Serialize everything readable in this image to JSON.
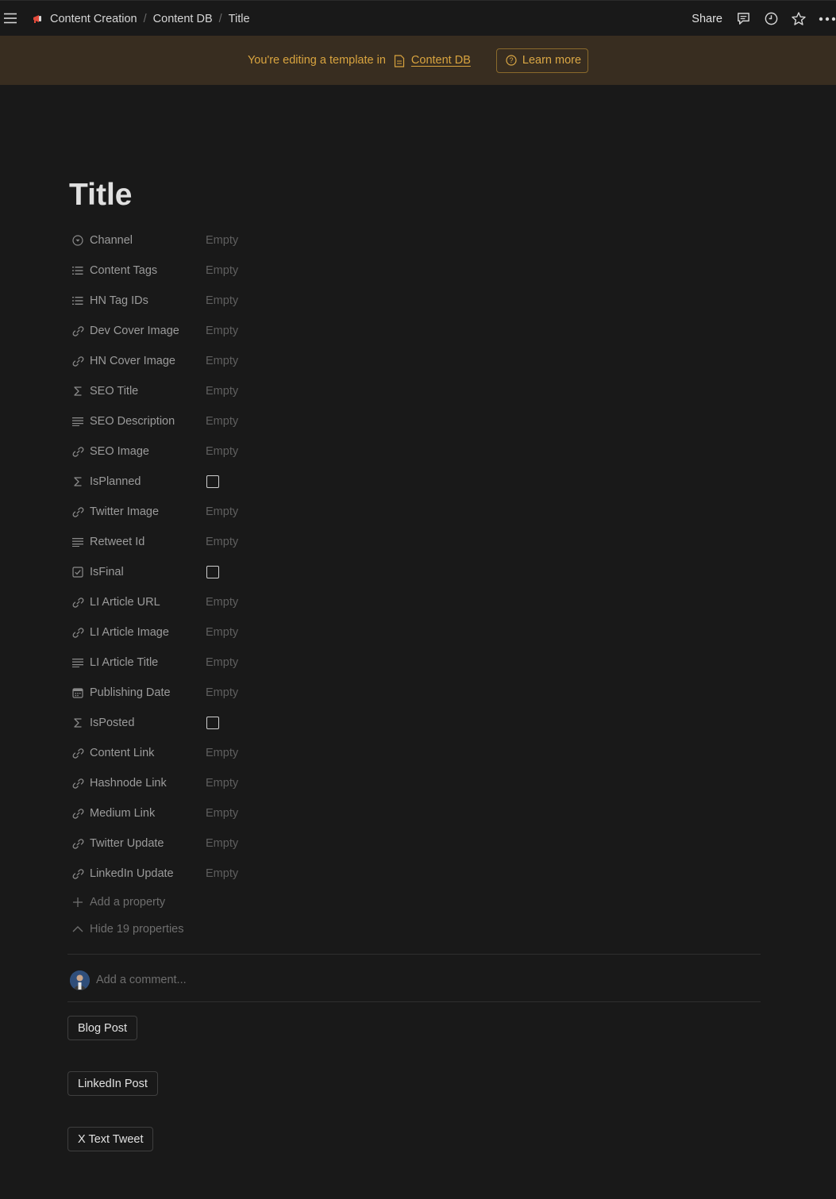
{
  "topbar": {
    "breadcrumbs": [
      "Content Creation",
      "Content DB",
      "Title"
    ],
    "share_label": "Share"
  },
  "banner": {
    "text": "You're editing a template in",
    "link": "Content DB",
    "learn_more": "Learn more"
  },
  "page": {
    "title": "Title"
  },
  "properties": [
    {
      "label": "Channel",
      "icon": "select-icon",
      "value": "Empty",
      "type": "text"
    },
    {
      "label": "Content Tags",
      "icon": "multi-select-icon",
      "value": "Empty",
      "type": "text"
    },
    {
      "label": "HN Tag IDs",
      "icon": "multi-select-icon",
      "value": "Empty",
      "type": "text"
    },
    {
      "label": "Dev Cover Image",
      "icon": "url-icon",
      "value": "Empty",
      "type": "text"
    },
    {
      "label": "HN Cover Image",
      "icon": "url-icon",
      "value": "Empty",
      "type": "text"
    },
    {
      "label": "SEO Title",
      "icon": "formula-icon",
      "value": "Empty",
      "type": "text"
    },
    {
      "label": "SEO Description",
      "icon": "text-icon",
      "value": "Empty",
      "type": "text"
    },
    {
      "label": "SEO Image",
      "icon": "url-icon",
      "value": "Empty",
      "type": "text"
    },
    {
      "label": "IsPlanned",
      "icon": "formula-icon",
      "value": "",
      "type": "checkbox"
    },
    {
      "label": "Twitter Image",
      "icon": "url-icon",
      "value": "Empty",
      "type": "text"
    },
    {
      "label": "Retweet Id",
      "icon": "text-icon",
      "value": "Empty",
      "type": "text"
    },
    {
      "label": "IsFinal",
      "icon": "checkbox-icon",
      "value": "",
      "type": "checkbox"
    },
    {
      "label": "LI Article URL",
      "icon": "url-icon",
      "value": "Empty",
      "type": "text"
    },
    {
      "label": "LI Article Image",
      "icon": "url-icon",
      "value": "Empty",
      "type": "text"
    },
    {
      "label": "LI Article Title",
      "icon": "text-icon",
      "value": "Empty",
      "type": "text"
    },
    {
      "label": "Publishing Date",
      "icon": "calendar-icon",
      "value": "Empty",
      "type": "text"
    },
    {
      "label": "IsPosted",
      "icon": "formula-icon",
      "value": "",
      "type": "checkbox"
    },
    {
      "label": "Content Link",
      "icon": "url-icon",
      "value": "Empty",
      "type": "text"
    },
    {
      "label": "Hashnode Link",
      "icon": "url-icon",
      "value": "Empty",
      "type": "text"
    },
    {
      "label": "Medium Link",
      "icon": "url-icon",
      "value": "Empty",
      "type": "text"
    },
    {
      "label": "Twitter Update",
      "icon": "url-icon",
      "value": "Empty",
      "type": "text"
    },
    {
      "label": "LinkedIn Update",
      "icon": "url-icon",
      "value": "Empty",
      "type": "text"
    }
  ],
  "add_property_label": "Add a property",
  "hide_properties_label": "Hide 19 properties",
  "comment": {
    "placeholder": "Add a comment..."
  },
  "template_buttons": [
    "Blog Post",
    "LinkedIn Post",
    "X Text Tweet"
  ],
  "colors": {
    "background": "#191919",
    "banner_bg": "#382d20",
    "banner_accent": "#d9a43f"
  }
}
